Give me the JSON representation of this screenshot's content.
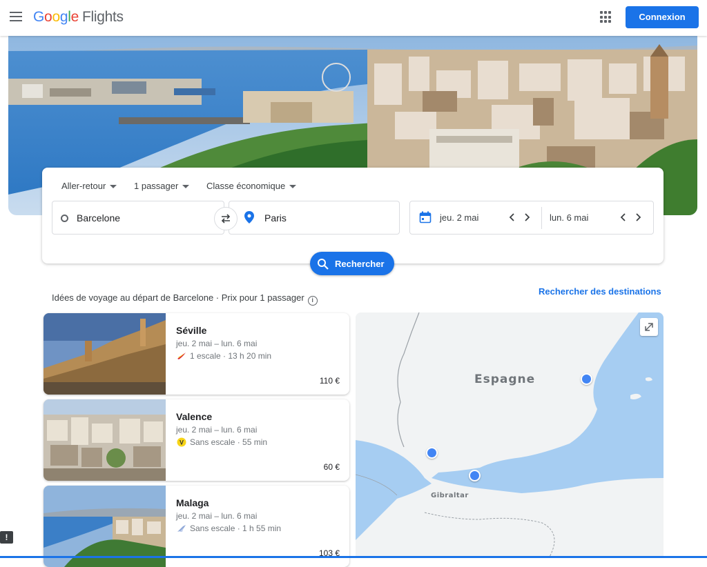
{
  "header": {
    "logo": {
      "g1": "G",
      "g2": "o",
      "g3": "o",
      "g4": "g",
      "g5": "l",
      "g6": "e",
      "product": "Flights"
    },
    "signin_label": "Connexion"
  },
  "search": {
    "trip_type": "Aller-retour",
    "passengers": "1 passager",
    "cabin_class": "Classe économique",
    "origin": "Barcelone",
    "destination": "Paris",
    "depart_date": "jeu. 2 mai",
    "return_date": "lun. 6 mai",
    "search_label": "Rechercher"
  },
  "ideas": {
    "heading": "Idées de voyage au départ de Barcelone · Prix pour 1 passager",
    "explore_label": "Rechercher des destinations",
    "cards": [
      {
        "city": "Séville",
        "dates": "jeu. 2 mai – lun. 6 mai",
        "stops": "1 escale · 13 h 20 min",
        "price": "110 €",
        "airline_icon": "iberia-icon"
      },
      {
        "city": "Valence",
        "dates": "jeu. 2 mai – lun. 6 mai",
        "stops": "Sans escale · 55 min",
        "price": "60 €",
        "airline_icon": "vueling-icon",
        "airline_badge": "V"
      },
      {
        "city": "Malaga",
        "dates": "jeu. 2 mai – lun. 6 mai",
        "stops": "Sans escale · 1 h 55 min",
        "price": "103 €",
        "airline_icon": "airline-icon"
      }
    ]
  },
  "map": {
    "country_label": "Espagne",
    "strait_label": "Gibraltar"
  },
  "colors": {
    "accent": "#1a73e8",
    "pin": "#4285f4",
    "sea": "#a6cdf2",
    "land": "#f1f3f4"
  }
}
